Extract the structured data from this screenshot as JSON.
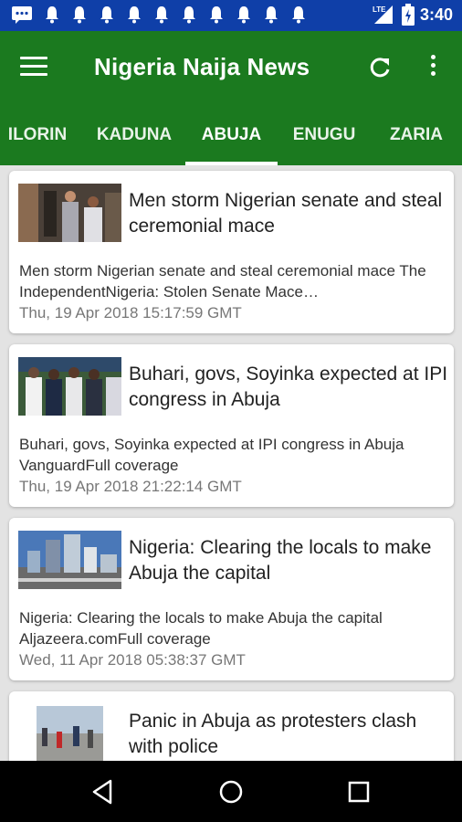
{
  "status_bar": {
    "time": "3:40",
    "network": "LTE",
    "icons": [
      "message-icon",
      "bell-icon",
      "bell-icon",
      "bell-icon",
      "bell-icon",
      "bell-icon",
      "bell-icon",
      "bell-icon",
      "bell-icon",
      "bell-icon",
      "bell-icon",
      "signal-icon",
      "battery-icon"
    ]
  },
  "app_bar": {
    "title": "Nigeria Naija News",
    "menu_icon": "menu-icon",
    "refresh_icon": "refresh-icon",
    "more_icon": "more-vert-icon"
  },
  "tabs": [
    {
      "label": "ILORIN",
      "selected": false
    },
    {
      "label": "KADUNA",
      "selected": false
    },
    {
      "label": "ABUJA",
      "selected": true
    },
    {
      "label": "ENUGU",
      "selected": false
    },
    {
      "label": "ZARIA",
      "selected": false
    }
  ],
  "articles": [
    {
      "title": "Men storm Nigerian senate and steal ceremonial mace",
      "description": "Men storm Nigerian senate and steal ceremonial mace  The IndependentNigeria: Stolen Senate Mace…",
      "date": "Thu, 19 Apr 2018 15:17:59 GMT"
    },
    {
      "title": "Buhari, govs, Soyinka expected at IPI congress in Abuja",
      "description": "Buhari, govs, Soyinka expected at IPI congress in Abuja  VanguardFull coverage",
      "date": "Thu, 19 Apr 2018 21:22:14 GMT"
    },
    {
      "title": "Nigeria: Clearing the locals to make Abuja the capital",
      "description": "Nigeria: Clearing the locals to make Abuja the capital Aljazeera.comFull coverage",
      "date": "Wed, 11 Apr 2018 05:38:37 GMT"
    },
    {
      "title": "Panic in Abuja as protesters clash with police",
      "description": "",
      "date": ""
    }
  ],
  "nav": {
    "back_icon": "back-icon",
    "home_icon": "home-icon",
    "recents_icon": "recents-icon"
  },
  "colors": {
    "status_bar": "#0f3fa8",
    "app_bar": "#1b7a1f",
    "background": "#e3e3e3"
  }
}
